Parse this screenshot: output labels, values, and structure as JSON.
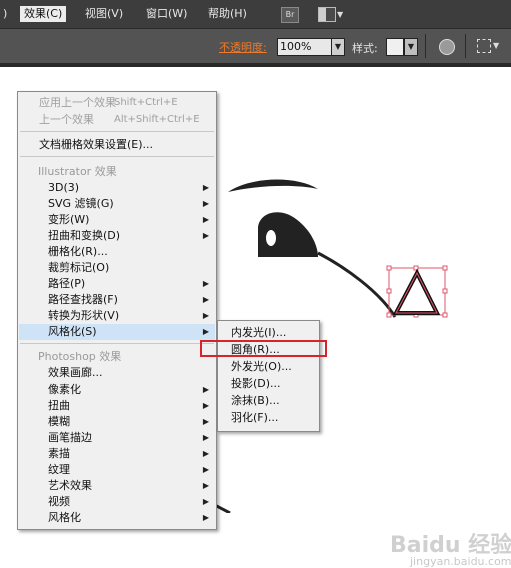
{
  "menubar": {
    "items": [
      {
        "label": ")"
      },
      {
        "label": "效果(C)"
      },
      {
        "label": "视图(V)"
      },
      {
        "label": "窗口(W)"
      },
      {
        "label": "帮助(H)"
      }
    ],
    "bridge_label": "Br"
  },
  "control_bar": {
    "opacity_label": "不透明度:",
    "opacity_value": "100%",
    "style_label": "样式:"
  },
  "effects_menu": {
    "apply_last": "应用上一个效果",
    "apply_last_shortcut": "Shift+Ctrl+E",
    "last_effect": "上一个效果",
    "last_effect_shortcut": "Alt+Shift+Ctrl+E",
    "raster_settings": "文档栅格效果设置(E)...",
    "illustrator_header": "Illustrator 效果",
    "illustrator_items": [
      "3D(3)",
      "SVG 滤镜(G)",
      "变形(W)",
      "扭曲和变换(D)",
      "栅格化(R)...",
      "裁剪标记(O)",
      "路径(P)",
      "路径查找器(F)",
      "转换为形状(V)",
      "风格化(S)"
    ],
    "photoshop_header": "Photoshop 效果",
    "photoshop_items": [
      "效果画廊...",
      "像素化",
      "扭曲",
      "模糊",
      "画笔描边",
      "素描",
      "纹理",
      "艺术效果",
      "视频",
      "风格化"
    ]
  },
  "stylize_submenu": {
    "items": [
      "内发光(I)...",
      "圆角(R)...",
      "外发光(O)...",
      "投影(D)...",
      "涂抹(B)...",
      "羽化(F)..."
    ]
  },
  "watermark": {
    "text": "Baidu 经验",
    "sub": "jingyan.baidu.com"
  },
  "colors": {
    "highlight": "#cfe3f7",
    "callout": "#d8232a",
    "menubar": "#3d3d3d",
    "opacity_label": "#f07a2a"
  }
}
